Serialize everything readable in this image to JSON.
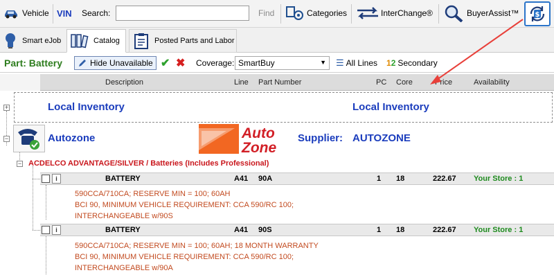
{
  "toolbar": {
    "vehicle_label": "Vehicle",
    "vin_label": "VIN",
    "search_label": "Search:",
    "search_value": "",
    "find_label": "Find",
    "categories_label": "Categories",
    "interchange_label": "InterChange®",
    "buyerassist_label": "BuyerAssist™"
  },
  "tabs": [
    {
      "label": "Smart eJob"
    },
    {
      "label": "Catalog"
    },
    {
      "label": "Posted Parts and Labor"
    }
  ],
  "partbar": {
    "part_label": "Part: Battery",
    "hide_unavailable_label": "Hide Unavailable",
    "coverage_label": "Coverage:",
    "coverage_value": "SmartBuy",
    "all_lines_label": "All Lines",
    "secondary_label": "Secondary"
  },
  "columns": {
    "description": "Description",
    "line": "Line",
    "part_number": "Part Number",
    "pc": "PC",
    "core": "Core",
    "price": "Price",
    "availability": "Availability"
  },
  "local_inventory": {
    "left": "Local Inventory",
    "right": "Local Inventory"
  },
  "supplier": {
    "name": "Autozone",
    "logo_top": "Auto",
    "logo_bottom": "Zone",
    "supplier_label": "Supplier:",
    "supplier_value": "AUTOZONE"
  },
  "category_title": "ACDELCO ADVANTAGE/SILVER / Batteries (Includes Professional)",
  "parts": [
    {
      "description": "BATTERY",
      "line": "A41",
      "part_number": "90A",
      "pc": "1",
      "core": "18",
      "price": "222.67",
      "availability": "Your Store : 1",
      "details": [
        "590CCA/710CA; RESERVE MIN = 100; 60AH",
        "BCI 90, MINIMUM VEHICLE REQUIREMENT: CCA 590/RC 100;",
        "INTERCHANGEABLE w/90S"
      ]
    },
    {
      "description": "BATTERY",
      "line": "A41",
      "part_number": "90S",
      "pc": "1",
      "core": "18",
      "price": "222.67",
      "availability": "Your Store : 1",
      "details": [
        "590CCA/710CA; RESERVE MIN = 100; 60AH; 18 MONTH WARRANTY",
        "BCI 90, MINIMUM VEHICLE REQUIREMENT: CCA 590/RC 100;",
        "INTERCHANGEABLE w/90A"
      ]
    }
  ],
  "colors": {
    "accent_blue": "#1b3dbd",
    "category_red": "#c9161c",
    "detail_orange": "#c24a1f",
    "store_green": "#1d8a1d",
    "autozone_orange": "#f26722"
  },
  "icons": [
    "vehicle-icon",
    "categories-icon",
    "interchange-icon",
    "buyerassist-icon",
    "dollar-sync-icon",
    "lightbulb-icon",
    "catalog-icon",
    "posted-parts-icon",
    "pencil-icon",
    "check-icon",
    "cross-icon",
    "list-icon",
    "secondary-icon",
    "phone-icon",
    "arrow-annotation"
  ]
}
